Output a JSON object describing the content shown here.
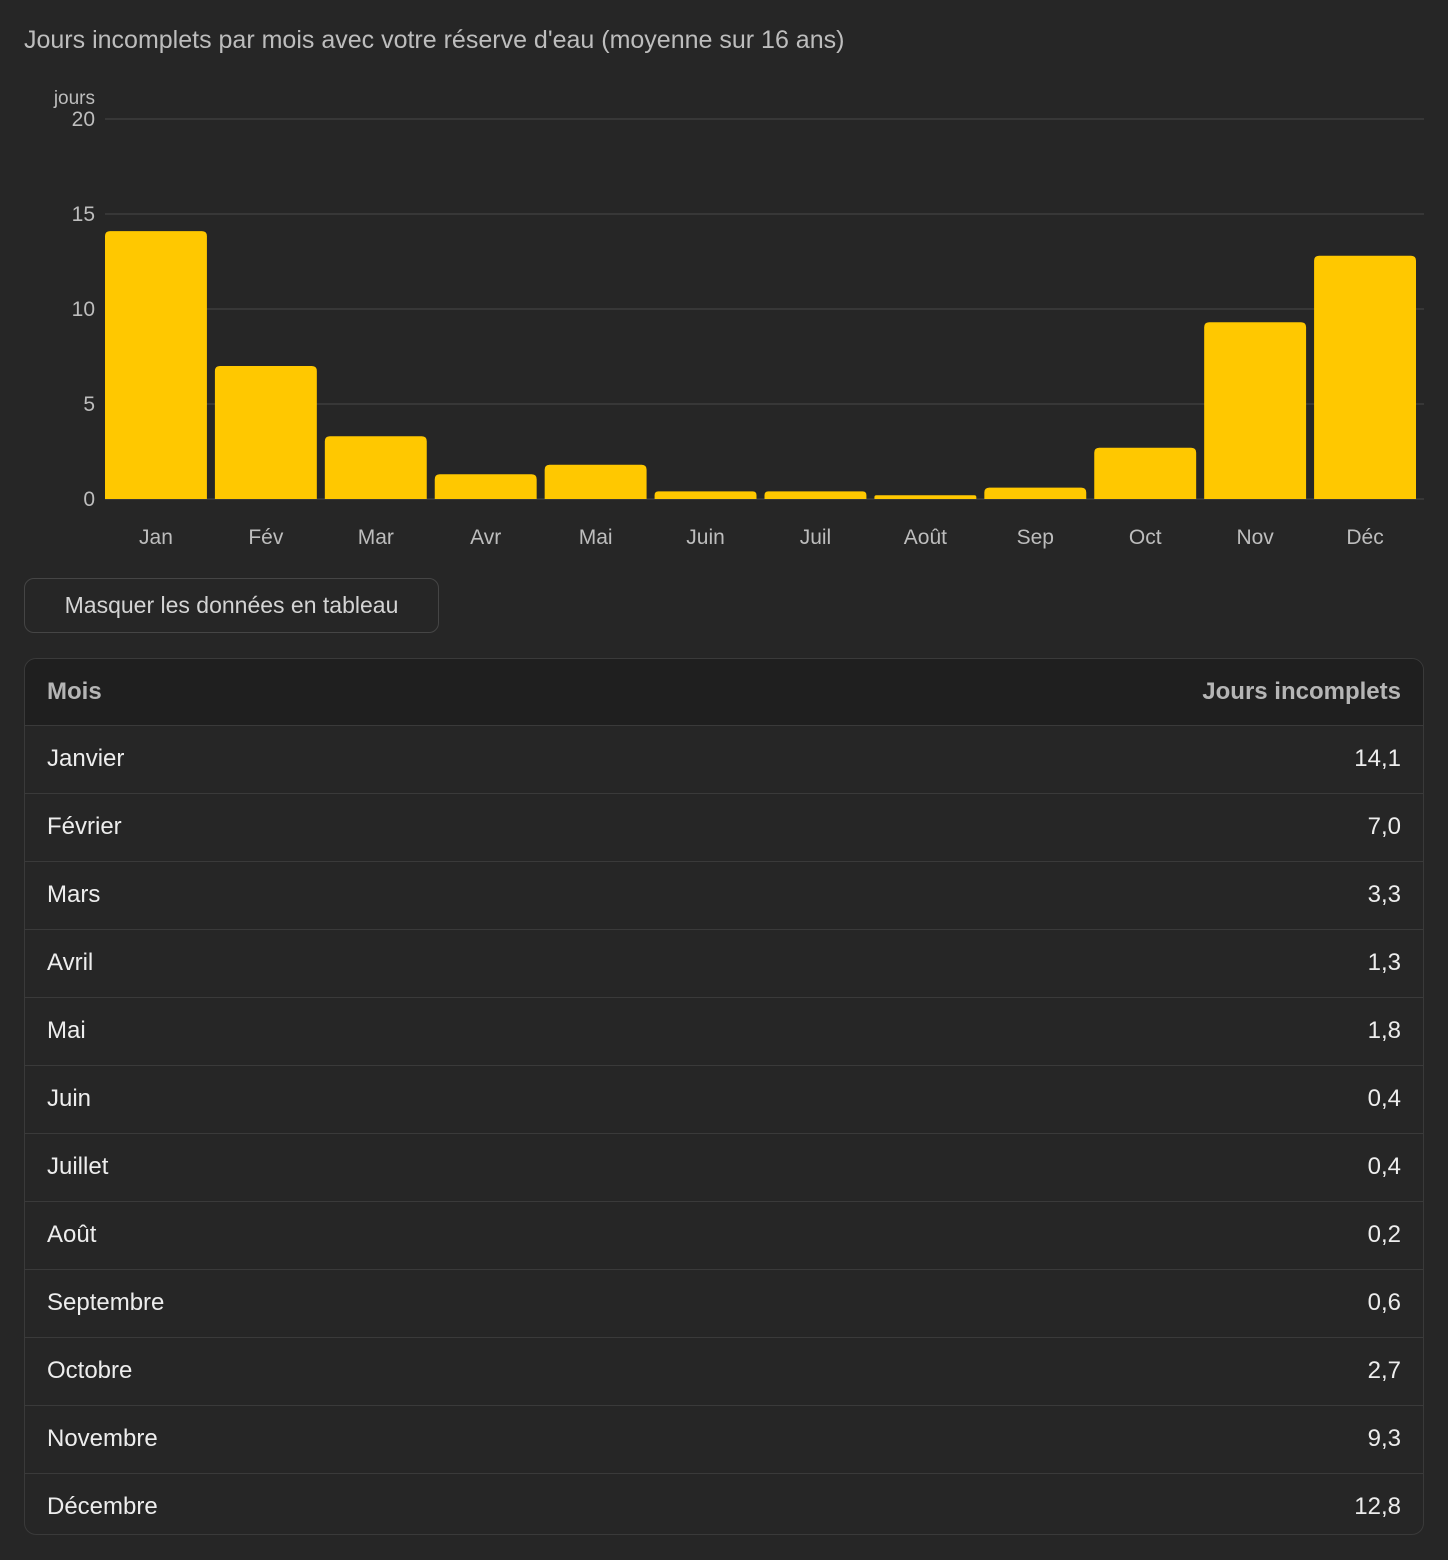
{
  "title": "Jours incomplets par mois avec votre réserve d'eau (moyenne sur 16 ans)",
  "toggle_label": "Masquer les données en tableau",
  "colors": {
    "bar": "#ffc800",
    "grid": "#3d3d3d",
    "tick": "#bdbdbd",
    "background": "#262626"
  },
  "chart_data": {
    "type": "bar",
    "title": "Jours incomplets par mois avec votre réserve d'eau (moyenne sur 16 ans)",
    "ylabel": "jours",
    "xlabel": "",
    "ylim": [
      0,
      20
    ],
    "yticks": [
      0,
      5,
      10,
      15,
      20
    ],
    "grid": true,
    "categories": [
      "Jan",
      "Fév",
      "Mar",
      "Avr",
      "Mai",
      "Juin",
      "Juil",
      "Août",
      "Sep",
      "Oct",
      "Nov",
      "Déc"
    ],
    "values": [
      14.1,
      7.0,
      3.3,
      1.3,
      1.8,
      0.4,
      0.4,
      0.2,
      0.6,
      2.7,
      9.3,
      12.8
    ]
  },
  "table": {
    "headers": [
      "Mois",
      "Jours incomplets"
    ],
    "rows": [
      [
        "Janvier",
        "14,1"
      ],
      [
        "Février",
        "7,0"
      ],
      [
        "Mars",
        "3,3"
      ],
      [
        "Avril",
        "1,3"
      ],
      [
        "Mai",
        "1,8"
      ],
      [
        "Juin",
        "0,4"
      ],
      [
        "Juillet",
        "0,4"
      ],
      [
        "Août",
        "0,2"
      ],
      [
        "Septembre",
        "0,6"
      ],
      [
        "Octobre",
        "2,7"
      ],
      [
        "Novembre",
        "9,3"
      ],
      [
        "Décembre",
        "12,8"
      ]
    ]
  }
}
